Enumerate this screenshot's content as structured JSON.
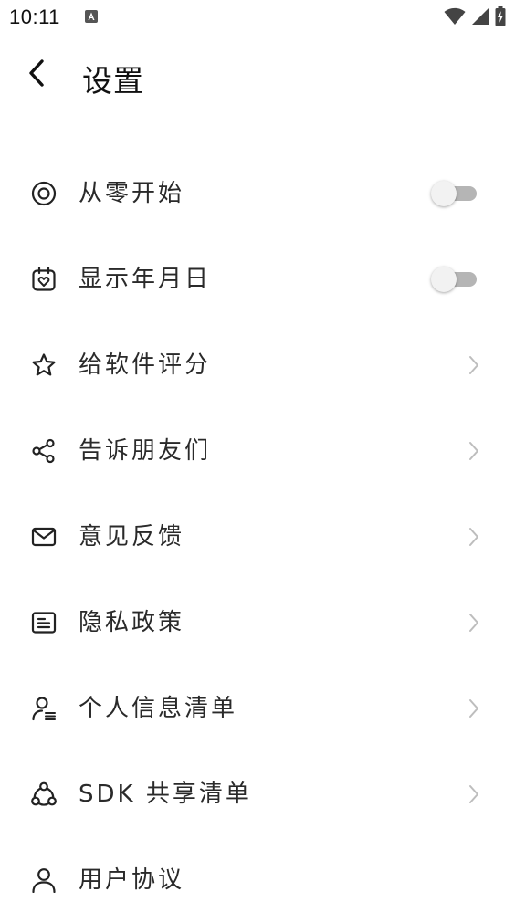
{
  "status_bar": {
    "time": "10:11",
    "icons": [
      "app-notification-icon",
      "wifi-icon",
      "signal-icon",
      "battery-charging-icon"
    ]
  },
  "header": {
    "back_icon": "chevron-left-icon",
    "title": "设置"
  },
  "settings": {
    "items": [
      {
        "label": "从零开始",
        "icon": "target-circle-icon",
        "control": "toggle",
        "on": false
      },
      {
        "label": "显示年月日",
        "icon": "calendar-heart-icon",
        "control": "toggle",
        "on": false
      },
      {
        "label": "给软件评分",
        "icon": "star-icon",
        "control": "chevron"
      },
      {
        "label": "告诉朋友们",
        "icon": "share-icon",
        "control": "chevron"
      },
      {
        "label": "意见反馈",
        "icon": "mail-icon",
        "control": "chevron"
      },
      {
        "label": "隐私政策",
        "icon": "document-icon",
        "control": "chevron"
      },
      {
        "label": "个人信息清单",
        "icon": "user-list-icon",
        "control": "chevron"
      },
      {
        "label": "SDK 共享清单",
        "icon": "nodes-share-icon",
        "control": "chevron"
      },
      {
        "label": "用户协议",
        "icon": "user-icon",
        "control": "chevron"
      }
    ]
  },
  "colors": {
    "text": "#2a2a2a",
    "icon": "#222222",
    "chevron": "#bdbdbd",
    "toggle_track": "#b5b5b5",
    "toggle_thumb": "#f2f2f2"
  }
}
